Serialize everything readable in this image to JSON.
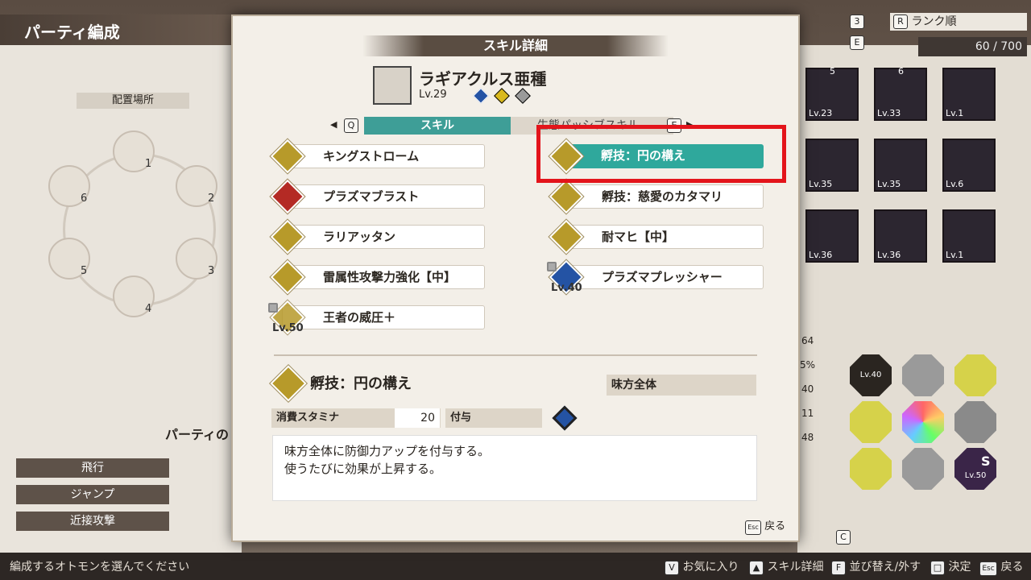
{
  "background_screen": {
    "title": "パーティ編成",
    "placement_label": "配置場所",
    "slots": [
      "1",
      "2",
      "3",
      "4",
      "5",
      "6"
    ],
    "party_label": "パーティの",
    "actions": [
      "飛行",
      "ジャンプ",
      "近接攻撃"
    ],
    "sort_key": "R",
    "sort_label": "ランク順",
    "key3": "3",
    "keyE": "E",
    "count": "60 / 700",
    "monster_levels": [
      "Lv.23",
      "Lv.33",
      "Lv.1",
      "Lv.35",
      "Lv.35",
      "Lv.6",
      "Lv.36",
      "Lv.36",
      "Lv.1"
    ],
    "monster_numbers": [
      "5",
      "6"
    ],
    "side_numbers": [
      "64",
      "5%",
      "40",
      "11",
      "48"
    ],
    "grid_levels": [
      "Lv.40",
      "Lv.50"
    ],
    "grid_s": "S",
    "keyC": "C"
  },
  "modal": {
    "title": "スキル詳細",
    "monster_name": "ラギアクルス亜種",
    "monster_level": "Lv.29",
    "tab_left_key": "Q",
    "tab_active": "スキル",
    "tab_inactive": "生態パッシブスキル",
    "tab_right_key": "E",
    "skills_left": [
      {
        "name": "キングストローム",
        "icon": "sun-icon",
        "color": "gold"
      },
      {
        "name": "プラズマブラスト",
        "icon": "blast-icon",
        "color": "red"
      },
      {
        "name": "ラリアッタン",
        "icon": "punch-icon",
        "color": "gold"
      },
      {
        "name": "雷属性攻撃力強化【中】",
        "icon": "power-icon",
        "color": "gold"
      },
      {
        "name": "王者の威圧＋",
        "icon": "shield-icon",
        "color": "gold",
        "locked_level": "Lv.50"
      }
    ],
    "skills_right": [
      {
        "name": "孵技：円の構え",
        "icon": "stance-icon",
        "color": "gold",
        "selected": true
      },
      {
        "name": "孵技：慈愛のカタマリ",
        "icon": "heart-icon",
        "color": "gold"
      },
      {
        "name": "耐マヒ【中】",
        "icon": "power-icon",
        "color": "gold"
      },
      {
        "name": "プラズマプレッシャー",
        "icon": "run-icon",
        "color": "blue",
        "locked_level": "Lv.40"
      }
    ],
    "detail": {
      "name": "孵技：円の構え",
      "target": "味方全体",
      "stamina_label": "消費スタミナ",
      "stamina_value": "20",
      "grant_label": "付与",
      "description_line1": "味方全体に防御力アップを付与する。",
      "description_line2": "使うたびに効果が上昇する。"
    },
    "back_key": "Esc",
    "back_label": "戻る"
  },
  "bottom_bar": {
    "hint": "編成するオトモンを選んでください",
    "controls": [
      {
        "key": "V",
        "label": "お気に入り"
      },
      {
        "key": "▲",
        "label": "スキル詳細"
      },
      {
        "key": "F",
        "label": "並び替え/外す"
      },
      {
        "key": "□",
        "label": "決定"
      },
      {
        "key": "Esc",
        "label": "戻る"
      }
    ]
  },
  "colors": {
    "teal": "#2fa89c",
    "gold": "#b79a2a",
    "red": "#b42a24",
    "blue": "#2453a4",
    "highlight": "#e3141b"
  }
}
